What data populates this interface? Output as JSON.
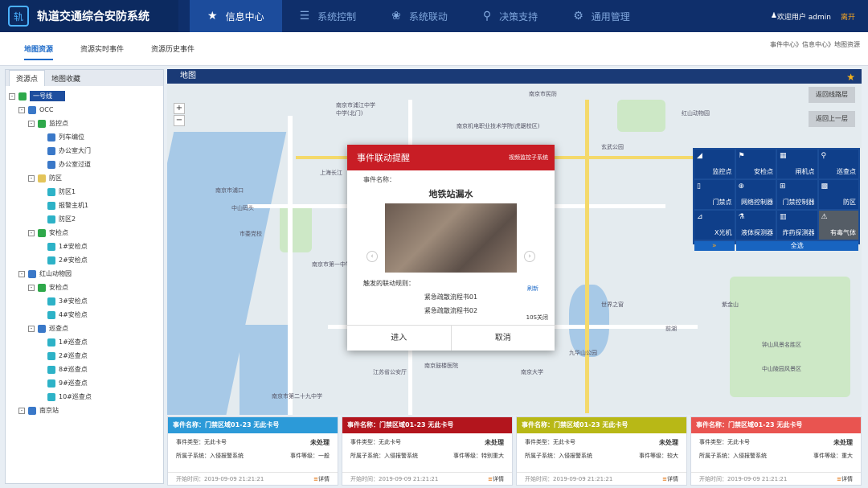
{
  "app": {
    "title": "轨道交通综合安防系统",
    "logo": "轨"
  },
  "nav": [
    {
      "icon": "★",
      "label": "信息中心"
    },
    {
      "icon": "☰",
      "label": "系统控制"
    },
    {
      "icon": "❀",
      "label": "系统联动"
    },
    {
      "icon": "⚲",
      "label": "决策支持"
    },
    {
      "icon": "⚙",
      "label": "通用管理"
    }
  ],
  "user": {
    "icon": "♟",
    "welcome": "欢迎用户 admin",
    "exit": "离开"
  },
  "subtabs": [
    "地图资源",
    "资源实时事件",
    "资源历史事件"
  ],
  "breadcrumb": "事件中心》信息中心》地图资源",
  "left": {
    "tabs": [
      "资源点",
      "地图收藏"
    ],
    "tree": [
      {
        "d": 0,
        "exp": "-",
        "icon": "green",
        "label": "一号线",
        "sel": true
      },
      {
        "d": 1,
        "exp": "-",
        "icon": "blue",
        "label": "OCC"
      },
      {
        "d": 2,
        "exp": "-",
        "icon": "green",
        "label": "监控点"
      },
      {
        "d": 3,
        "icon": "blue",
        "label": "列车编位"
      },
      {
        "d": 3,
        "icon": "blue",
        "label": "办公室大门"
      },
      {
        "d": 3,
        "icon": "blue",
        "label": "办公室过道"
      },
      {
        "d": 2,
        "exp": "-",
        "icon": "yellow",
        "label": "防区"
      },
      {
        "d": 3,
        "icon": "teal",
        "label": "防区1"
      },
      {
        "d": 3,
        "icon": "teal",
        "label": "报警主机1"
      },
      {
        "d": 3,
        "icon": "teal",
        "label": "防区2"
      },
      {
        "d": 2,
        "exp": "-",
        "icon": "green",
        "label": "安检点"
      },
      {
        "d": 3,
        "icon": "teal",
        "label": "1#安检点"
      },
      {
        "d": 3,
        "icon": "teal",
        "label": "2#安检点"
      },
      {
        "d": 1,
        "exp": "-",
        "icon": "blue",
        "label": "红山动物园"
      },
      {
        "d": 2,
        "exp": "-",
        "icon": "green",
        "label": "安检点"
      },
      {
        "d": 3,
        "icon": "teal",
        "label": "3#安检点"
      },
      {
        "d": 3,
        "icon": "teal",
        "label": "4#安检点"
      },
      {
        "d": 2,
        "exp": "-",
        "icon": "blue",
        "label": "巡查点"
      },
      {
        "d": 3,
        "icon": "teal",
        "label": "1#巡查点"
      },
      {
        "d": 3,
        "icon": "teal",
        "label": "2#巡查点"
      },
      {
        "d": 3,
        "icon": "teal",
        "label": "8#巡查点"
      },
      {
        "d": 3,
        "icon": "teal",
        "label": "9#巡查点"
      },
      {
        "d": 3,
        "icon": "teal",
        "label": "10#巡查点"
      },
      {
        "d": 1,
        "exp": "-",
        "icon": "blue",
        "label": "南京站"
      }
    ]
  },
  "map": {
    "title": "地图",
    "zoom_in": "+",
    "zoom_out": "−",
    "return_line": "返回线路层",
    "return_up": "返回上一层",
    "labels": [
      "南京市浦口",
      "上海长江",
      "中山码头",
      "市委党校",
      "南京市浦江中学",
      "中学(北门)",
      "南京机电职业技术学院(虎踞校区)",
      "南京市民防",
      "南京市第一中学",
      "江苏省公安厅",
      "南京鼓楼医院",
      "南京市第二十九中学",
      "南京大学",
      "红山动物园",
      "玄武公园",
      "钟山风景名胜区",
      "中山陵园风景区",
      "紫金山",
      "世界之窗",
      "前湖",
      "九华山公园"
    ],
    "tools": [
      {
        "icon": "◢",
        "label": "监控点"
      },
      {
        "icon": "⚑",
        "label": "安检点"
      },
      {
        "icon": "▦",
        "label": "闸机点"
      },
      {
        "icon": "⚲",
        "label": "巡查点"
      },
      {
        "icon": "▯",
        "label": "门禁点"
      },
      {
        "icon": "⊕",
        "label": "网络控制器"
      },
      {
        "icon": "⊞",
        "label": "门禁控制器"
      },
      {
        "icon": "▩",
        "label": "防区"
      },
      {
        "icon": "⊿",
        "label": "X光机"
      },
      {
        "icon": "⚗",
        "label": "液体探测器"
      },
      {
        "icon": "▥",
        "label": "炸药探测器"
      },
      {
        "icon": "⚠",
        "label": "有毒气体"
      }
    ],
    "more": "»",
    "all": "全选"
  },
  "dialog": {
    "title": "事件联动提醒",
    "video": "视频监控子系统",
    "name_label": "事件名称：",
    "name": "地铁站漏水",
    "refresh": "刷新",
    "rules_label": "触发的联动规则：",
    "rules": [
      "紧急疏散流程书01",
      "紧急疏散流程书02"
    ],
    "countdown": "10S关闭",
    "enter": "进入",
    "cancel": "取消"
  },
  "cards": [
    {
      "color": "#2c9ad8",
      "title": "事件名称：门禁区域01-23 无此卡号",
      "type": "事件类型：无此卡号",
      "status": "未处理",
      "sys": "所属子系统：入侵报警系统",
      "level": "事件等级：一般",
      "time": "开始时间：2019-09-09 21:21:21",
      "detail": "详情"
    },
    {
      "color": "#b3151d",
      "title": "事件名称：门禁区域01-23 无此卡号",
      "type": "事件类型：无此卡号",
      "status": "未处理",
      "sys": "所属子系统：入侵报警系统",
      "level": "事件等级：特别重大",
      "time": "开始时间：2019-09-09 21:21:21",
      "detail": "详情"
    },
    {
      "color": "#b8b816",
      "title": "事件名称：门禁区域01-23 无此卡号",
      "type": "事件类型：无此卡号",
      "status": "未处理",
      "sys": "所属子系统：入侵报警系统",
      "level": "事件等级：较大",
      "time": "开始时间：2019-09-09 21:21:21",
      "detail": "详情"
    },
    {
      "color": "#e95450",
      "title": "事件名称：门禁区域01-23 无此卡号",
      "type": "事件类型：无此卡号",
      "status": "未处理",
      "sys": "所属子系统：入侵报警系统",
      "level": "事件等级：重大",
      "time": "开始时间：2019-09-09 21:21:21",
      "detail": "详情"
    }
  ]
}
